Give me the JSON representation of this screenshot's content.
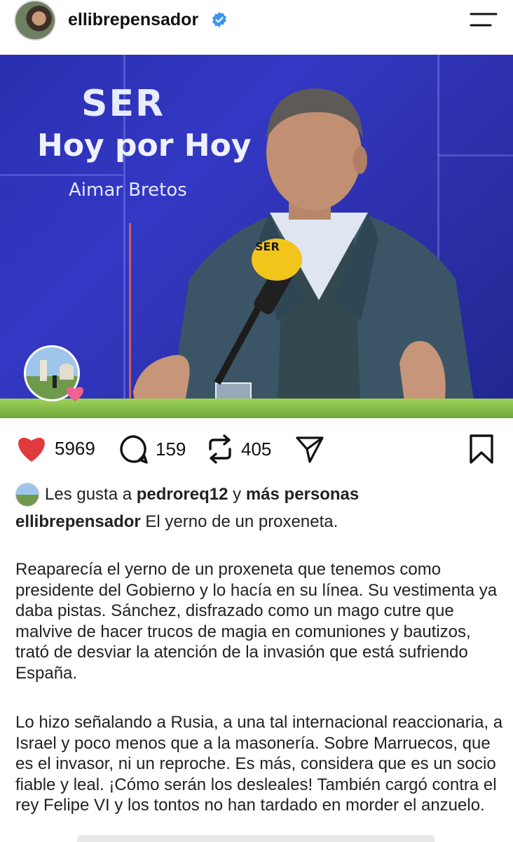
{
  "header": {
    "username": "ellibrepensador",
    "verified_color": "#3897f0",
    "menu_icon": "hamburger-icon"
  },
  "media": {
    "brand": "SER",
    "show_title": "Hoy por Hoy",
    "host": "Aimar Bretos",
    "mic_brand": "SER"
  },
  "actions": {
    "likes": "5969",
    "comments": "159",
    "reposts": "405",
    "like_color": "#e0393e"
  },
  "caption": {
    "likes_prefix": "Les gusta a",
    "liker": "pedroreq12",
    "likes_joiner": "y",
    "likes_more": "más personas",
    "author": "ellibrepensador",
    "title": "El yerno de un proxeneta.",
    "paragraph1": "Reaparecía el yerno de un proxeneta que tenemos como presidente del Gobierno y lo hacía en su línea. Su vestimenta ya daba pistas. Sánchez, disfrazado como un mago cutre que malvive de hacer trucos de magia en comuniones y bautizos, trató de desviar la atención de la invasión que está sufriendo España.",
    "paragraph2": "Lo hizo señalando a Rusia, a una tal internacional reaccionaria, a Israel y poco menos que a la masonería. Sobre Marruecos, que es el invasor, ni un reproche. Es más, considera que es un socio fiable y leal. ¡Cómo serán los desleales! También cargó contra el rey Felipe VI y los tontos no han tardado en morder el anzuelo."
  }
}
